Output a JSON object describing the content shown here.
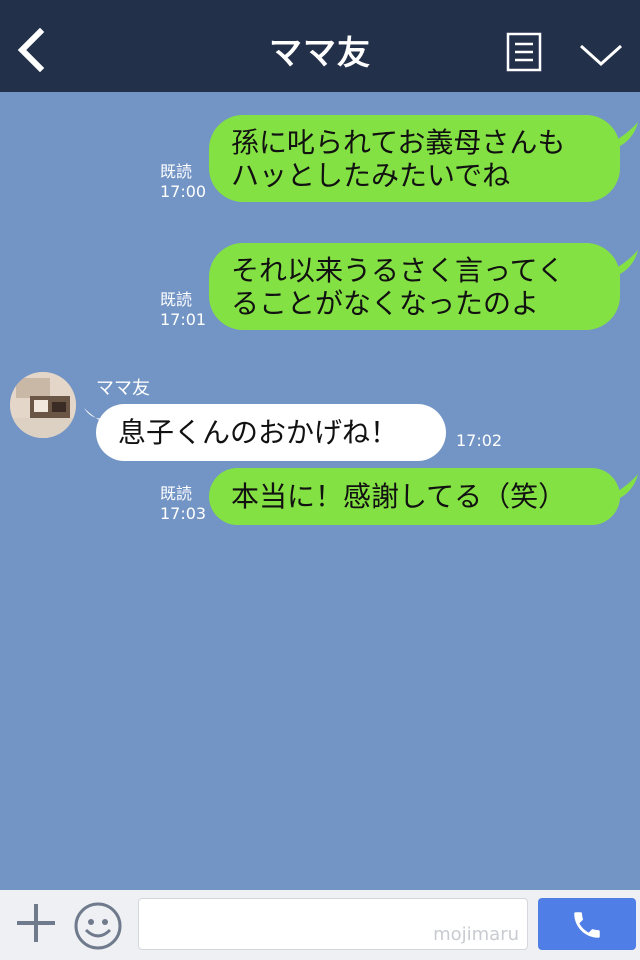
{
  "header": {
    "title": "ママ友",
    "back_icon": "chevron-left-icon",
    "menu_icon": "document-icon",
    "more_icon": "chevron-down-icon"
  },
  "messages": [
    {
      "side": "right",
      "text_line1": "孫に叱られてお義母さんも",
      "text_line2": "ハッとしたみたいでね",
      "read": "既読",
      "time": "17:00"
    },
    {
      "side": "right",
      "text_line1": "それ以来うるさく言ってく",
      "text_line2": "ることがなくなったのよ",
      "read": "既読",
      "time": "17:01"
    },
    {
      "side": "left",
      "sender": "ママ友",
      "text": "息子くんのおかげね！",
      "time": "17:02"
    },
    {
      "side": "right",
      "text": "本当に！感謝してる（笑）",
      "read": "既読",
      "time": "17:03"
    }
  ],
  "footer": {
    "input_placeholder": "",
    "watermark": "mojimaru",
    "plus_icon": "plus-icon",
    "emoji_icon": "smile-icon",
    "call_icon": "phone-icon"
  },
  "colors": {
    "header_bg": "#23304a",
    "chat_bg": "#7395c5",
    "my_bubble": "#84e143",
    "their_bubble": "#ffffff",
    "call_button": "#4f7fe6"
  }
}
